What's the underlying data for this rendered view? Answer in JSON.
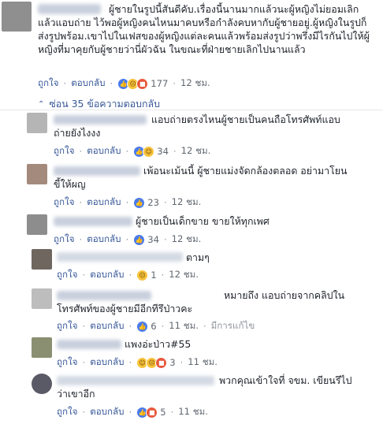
{
  "main": {
    "text": "ผู้ชายในรูปนี้สันดีคับ.เรื่องนี้นานมากแล้วนะผู้หญิงไม่ยอมเลิกแล้วแอบถ่าย ไว้พอผู้หญิงคนไหนมาคบหรือกำลังคบหากับผู้ชายอยู่.ผู้หญิงในรูปก็ส่งรูปพร้อม.เขาไปในเฟสของผู้หญิงแต่ละคนแล้วพร้อมส่งรูปว่าพรึ่งมีไรกันไปให้ผู้หญิงที่มาคุยกับผู้ชายว่านี่ผัวฉัน ในขณะที่ฝ่ายชายเลิกไปนานแล้ว",
    "like_label": "ถูกใจ",
    "reply_label": "ตอบกลับ",
    "reactions": [
      "like",
      "sad",
      "angry"
    ],
    "count": "177",
    "time": "12 ชม."
  },
  "replies_toggle": {
    "label": "ซ่อน 35 ข้อความตอบกลับ",
    "icon": "chevron-up-icon"
  },
  "replies": [
    {
      "text": "แอบถ่ายตรงไหนผู้ชายเป็นคนถือโทรศัพท์แอบถ่ายยังไงงง",
      "reactions": [
        "like",
        "haha"
      ],
      "count": "34",
      "time": "12 ชม.",
      "edited": ""
    },
    {
      "text": "เพ้อนะเม้นนี้ ผู้ชายแม่งจัดกล้องตลอด อย่ามาโยนขี้ให้ผญ",
      "reactions": [
        "like"
      ],
      "count": "23",
      "time": "12 ชม.",
      "edited": ""
    },
    {
      "text": "ผู้ชายเป็นเด็กขาย ขายให้ทุกเพศ",
      "reactions": [
        "like"
      ],
      "count": "34",
      "time": "12 ชม.",
      "edited": ""
    },
    {
      "text": "ตามๆ",
      "reactions": [
        "sad"
      ],
      "count": "1",
      "time": "12 ชม.",
      "edited": ""
    },
    {
      "text": "หมายถึง แอบถ่ายจากคลิปในโทรศัพท์ของผู้ชายมีอีกทีรึป่าวคะ",
      "reactions": [
        "like"
      ],
      "count": "6",
      "time": "11 ชม.",
      "edited": "มีการแก้ไข"
    },
    {
      "text": "แพงอ่ะป่าว#55",
      "reactions": [
        "haha",
        "sad",
        "angry"
      ],
      "count": "3",
      "time": "11 ชม.",
      "edited": ""
    },
    {
      "text": "พวกคุณเข้าใจที่ จขม. เขียนรึไปว่าเขาอีก",
      "reactions": [
        "like",
        "angry"
      ],
      "count": "5",
      "time": "11 ชม.",
      "edited": ""
    }
  ]
}
